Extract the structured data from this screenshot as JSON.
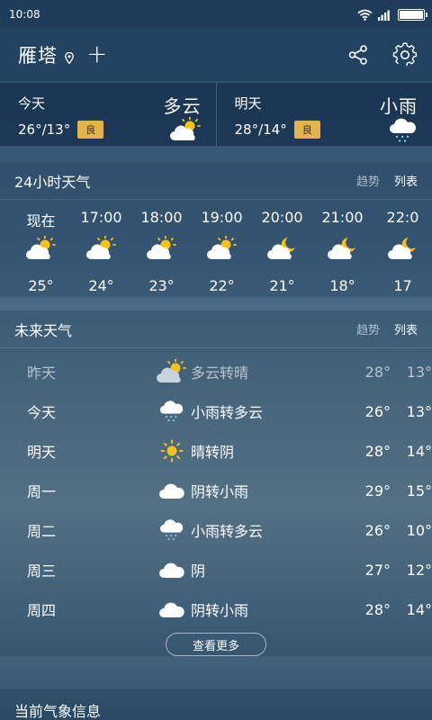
{
  "status": {
    "time": "10:08"
  },
  "header": {
    "city": "雁塔"
  },
  "today": {
    "day": "今天",
    "temp": "26°/13°",
    "aqi": "良",
    "condition": "多云",
    "icon": "partly-cloudy-icon"
  },
  "tomorrow": {
    "day": "明天",
    "temp": "28°/14°",
    "aqi": "良",
    "condition": "小雨",
    "icon": "light-rain-icon"
  },
  "hourly": {
    "title": "24小时天气",
    "trend": "趋势",
    "list": "列表",
    "items": [
      {
        "time": "现在",
        "icon": "partly-cloudy-icon",
        "temp": "25°"
      },
      {
        "time": "17:00",
        "icon": "partly-cloudy-icon",
        "temp": "24°"
      },
      {
        "time": "18:00",
        "icon": "partly-cloudy-icon",
        "temp": "23°"
      },
      {
        "time": "19:00",
        "icon": "partly-cloudy-icon",
        "temp": "22°"
      },
      {
        "time": "20:00",
        "icon": "cloudy-night-icon",
        "temp": "21°"
      },
      {
        "time": "21:00",
        "icon": "cloudy-night-icon",
        "temp": "18°"
      },
      {
        "time": "22:0",
        "icon": "cloudy-night-icon",
        "temp": "17"
      }
    ]
  },
  "future": {
    "title": "未来天气",
    "trend": "趋势",
    "list": "列表",
    "days": [
      {
        "day": "昨天",
        "icon": "partly-cloudy-icon",
        "condition": "多云转晴",
        "high": "28°",
        "low": "13°"
      },
      {
        "day": "今天",
        "icon": "light-rain-icon",
        "condition": "小雨转多云",
        "high": "26°",
        "low": "13°"
      },
      {
        "day": "明天",
        "icon": "sunny-icon",
        "condition": "晴转阴",
        "high": "28°",
        "low": "14°"
      },
      {
        "day": "周一",
        "icon": "overcast-icon",
        "condition": "阴转小雨",
        "high": "29°",
        "low": "15°"
      },
      {
        "day": "周二",
        "icon": "light-rain-icon",
        "condition": "小雨转多云",
        "high": "26°",
        "low": "10°"
      },
      {
        "day": "周三",
        "icon": "overcast-icon",
        "condition": "阴",
        "high": "27°",
        "low": "12°"
      },
      {
        "day": "周四",
        "icon": "overcast-icon",
        "condition": "阴转小雨",
        "high": "28°",
        "low": "14°"
      }
    ],
    "more": "查看更多"
  },
  "current_info": {
    "title": "当前气象信息"
  },
  "colors": {
    "aqi_badge": "#e3b34c",
    "sun": "#f6c21a",
    "header": "#224262"
  }
}
